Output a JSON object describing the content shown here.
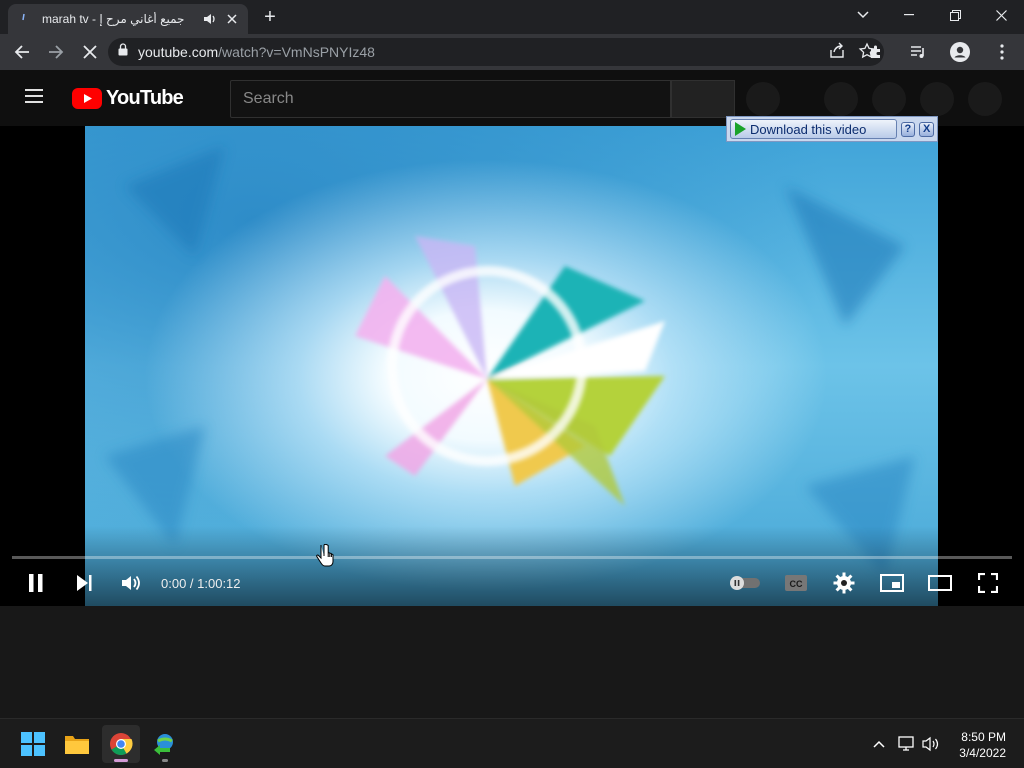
{
  "browser": {
    "tab": {
      "title": "marah tv - جميع أغاني مرح إ"
    },
    "new_tab_label": "+",
    "address": {
      "domain": "youtube.com",
      "path": "/watch?v=VmNsPNYIz48"
    }
  },
  "youtube": {
    "logo_text": "YouTube",
    "search_placeholder": "Search"
  },
  "download_overlay": {
    "label": "Download this video",
    "help": "?",
    "close": "X"
  },
  "player": {
    "time_current": "0:00",
    "time_total": "1:00:12",
    "time_display": "0:00 / 1:00:12",
    "progress_fraction": 0.0
  },
  "taskbar": {
    "clock_time": "8:50 PM",
    "clock_date": "3/4/2022"
  },
  "colors": {
    "youtube_red": "#ff0000",
    "chrome_frame": "#202124",
    "toolbar": "#35363a"
  }
}
